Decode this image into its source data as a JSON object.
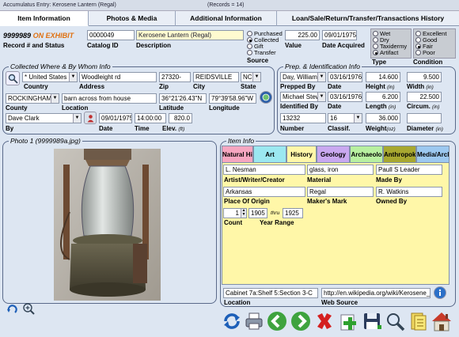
{
  "window": {
    "title": "Accumulatus Entry: Kerosene Lantern (Regal)",
    "records": "(Records = 14)"
  },
  "tabs": [
    "Item Information",
    "Photos & Media",
    "Additional Information",
    "Loan/Sale/Return/Transfer/Transactions History"
  ],
  "record": {
    "number": "9999989",
    "status": "ON EXHIBIT",
    "label": "Record # and Status",
    "catalog_id": "0000049",
    "catalog_label": "Catalog ID",
    "description": "Kerosene Lantern (Regal)",
    "description_label": "Description"
  },
  "source": {
    "label": "Source",
    "options": [
      "Purchased",
      "Collected",
      "Gift",
      "Transfer"
    ],
    "selected": "Collected"
  },
  "value": {
    "amount": "225.00",
    "label": "Value",
    "date": "09/01/1975",
    "date_label": "Date Acquired"
  },
  "type": {
    "label": "Type",
    "options": [
      "Wet",
      "Dry",
      "Taxidermy",
      "Artifact"
    ],
    "selected": "Artifact"
  },
  "condition": {
    "label": "Condition",
    "options": [
      "Excellent",
      "Good",
      "Fair",
      "Poor"
    ],
    "selected": "Fair"
  },
  "collected": {
    "title": "Collected Where & By Whom Info",
    "country": "* United States",
    "country_label": "Country",
    "address": "Woodleight rd",
    "address_label": "Address",
    "zip": "27320-",
    "zip_label": "Zip",
    "city": "REIDSVILLE",
    "city_label": "City",
    "state": "NC",
    "state_label": "State",
    "county": "ROCKINGHAM",
    "county_label": "County",
    "location": "barn across from house",
    "location_label": "Location",
    "latitude": "36°21'26.43\"N",
    "latitude_label": "Latitude",
    "longitude": "79°39'58.96\"W",
    "longitude_label": "Longitude",
    "by": "Dave Clark",
    "by_label": "By",
    "date": "09/01/1975",
    "date_label": "Date",
    "time": "14:00:00",
    "time_label": "Time",
    "elev": "820.0",
    "elev_label": "Elev.",
    "elev_unit": "(ft)"
  },
  "prep": {
    "title": "Prep. & Identification Info",
    "prepped_by": "Day, William",
    "prepped_date": "03/16/1976",
    "prepped_label": "Prepped By",
    "date_label": "Date",
    "identified_by": "Michael Stew",
    "identified_date": "03/16/1976",
    "identified_label": "Identified By",
    "number": "13232",
    "number_label": "Number",
    "classif": "16",
    "classif_label": "Classif.",
    "height": "14.600",
    "height_label": "Height",
    "unit": "(in)",
    "width": "9.500",
    "width_label": "Width",
    "length": "6.200",
    "length_label": "Length",
    "circum": "22.500",
    "circum_label": "Circum.",
    "weight": "36.000",
    "weight_label": "Weight",
    "weight_unit": "(oz)",
    "diameter": "",
    "diameter_label": "Diameter",
    "diameter_unit": "(in)"
  },
  "photo": {
    "title": "Photo 1 (9999989a.jpg)"
  },
  "item": {
    "title": "Item Info",
    "tabs": [
      {
        "label": "Natural His",
        "color": "#f6a6c0"
      },
      {
        "label": "Art",
        "color": "#9be8f0"
      },
      {
        "label": "History",
        "color": "#fff7a8"
      },
      {
        "label": "Geology",
        "color": "#c9a8f0"
      },
      {
        "label": "Archaeolo",
        "color": "#b8f0a0"
      },
      {
        "label": "Anthropok",
        "color": "#a8a830"
      },
      {
        "label": "Media/Arch",
        "color": "#9cc8f0"
      }
    ],
    "artist": "L. Nesman",
    "artist_label": "Artist/Writer/Creator",
    "material": "glass, iron",
    "material_label": "Material",
    "made_by": "Paull S Leader",
    "made_by_label": "Made By",
    "origin": "Arkansas",
    "origin_label": "Place Of Origin",
    "makers_mark": "Regal",
    "makers_mark_label": "Maker's Mark",
    "owned_by": "R. Watkins",
    "owned_by_label": "Owned By",
    "count": "1",
    "count_label": "Count",
    "year_from": "1905",
    "thru": "thru",
    "year_to": "1925",
    "year_label": "Year Range",
    "location": "Cabinet 7a:Shelf 5:Section 3-C",
    "location_label": "Location",
    "web": "http://en.wikipedia.org/wiki/Kerosene_lan",
    "web_label": "Web Source"
  },
  "toolbar": [
    "refresh-icon",
    "print-icon",
    "back-icon",
    "forward-icon",
    "delete-icon",
    "add-icon",
    "save-icon",
    "search-icon",
    "report-icon",
    "home-icon"
  ]
}
